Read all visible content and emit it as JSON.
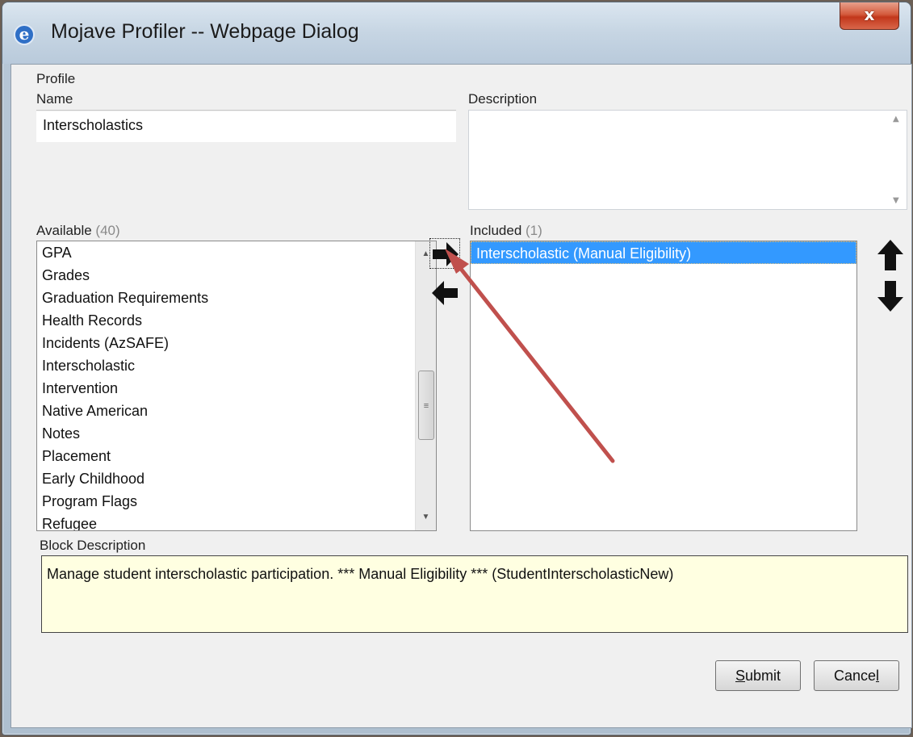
{
  "window": {
    "title": "Mojave Profiler -- Webpage Dialog",
    "close_label": "x"
  },
  "profile": {
    "section_label": "Profile",
    "name_label": "Name",
    "name_value": "Interscholastics",
    "description_label": "Description",
    "description_value": ""
  },
  "available": {
    "label": "Available",
    "count": "(40)",
    "items": [
      "GPA",
      "Grades",
      "Graduation Requirements",
      "Health Records",
      "Incidents (AzSAFE)",
      "Interscholastic",
      "Intervention",
      "Native American",
      "Notes",
      "Placement",
      "Early Childhood",
      "Program Flags",
      "Refugee"
    ]
  },
  "included": {
    "label": "Included",
    "count": "(1)",
    "items": [
      "Interscholastic (Manual Eligibility)"
    ],
    "selected_index": 0
  },
  "block_description": {
    "label": "Block Description",
    "text": "Manage student interscholastic participation. *** Manual Eligibility *** (StudentInterscholasticNew)"
  },
  "buttons": {
    "submit_first": "S",
    "submit_rest": "ubmit",
    "cancel_first": "Cance",
    "cancel_rest": "l"
  },
  "colors": {
    "selection": "#3399ff",
    "annotation_arrow": "#c0504d",
    "description_bg": "#ffffe1"
  }
}
